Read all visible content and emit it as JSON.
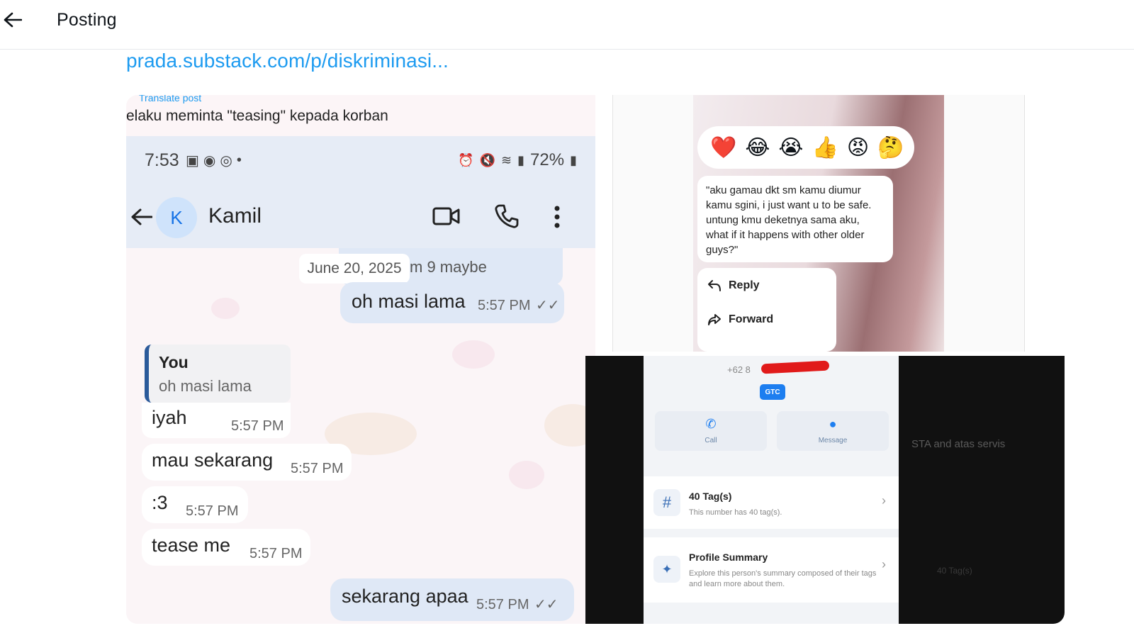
{
  "header": {
    "title": "Posting",
    "back_icon": "arrow-left-icon"
  },
  "post": {
    "link_text": "prada.substack.com/p/diskriminasi..."
  },
  "chat_screenshot": {
    "translate_label": "Translate post",
    "caption": "elaku meminta \"teasing\" kepada korban",
    "status_time": "7:53",
    "status_battery": "72%",
    "contact_initial": "K",
    "contact_name": "Kamil",
    "date_chip": "June 20, 2025",
    "top_partial": "m 9 maybe",
    "messages": [
      {
        "dir": "out",
        "text": "oh masi lama",
        "time": "5:57 PM"
      },
      {
        "dir": "in",
        "text": "iyah",
        "time": "5:57 PM"
      },
      {
        "dir": "in",
        "text": "mau sekarang",
        "time": "5:57 PM"
      },
      {
        "dir": "in",
        "text": ":3",
        "time": "5:57 PM"
      },
      {
        "dir": "in",
        "text": "tease me",
        "time": "5:57 PM"
      },
      {
        "dir": "out",
        "text": "sekarang apaa",
        "time": "5:57 PM"
      }
    ],
    "quote": {
      "who": "You",
      "text": "oh masi lama"
    }
  },
  "reaction_screenshot": {
    "emojis": [
      "❤️",
      "😂",
      "😭",
      "👍",
      "😡",
      "🤔"
    ],
    "message": "\"aku gamau dkt sm kamu diumur kamu sgini, i just want u to be safe. untung kmu deketnya sama aku, what if it happens with other older guys?\"",
    "menu": [
      {
        "label": "Reply",
        "icon": "reply-icon"
      },
      {
        "label": "Forward",
        "icon": "forward-icon"
      }
    ]
  },
  "contact_screenshot": {
    "number": "+62 8",
    "badge": "GTC",
    "actions": [
      {
        "label": "Call",
        "icon": "phone-icon"
      },
      {
        "label": "Message",
        "icon": "message-icon"
      }
    ],
    "rows": [
      {
        "title": "40 Tag(s)",
        "subtitle": "This number has 40 tag(s).",
        "icon": "hash-icon"
      },
      {
        "title": "Profile Summary",
        "subtitle": "Explore this person's summary composed of their tags and learn more about them.",
        "icon": "sparkle-icon"
      }
    ],
    "ghost_text": "STA and atas servis",
    "ghost_tags": "40 Tag(s)"
  },
  "colors": {
    "link": "#1d9bf0",
    "chat_header": "#e6ecf6",
    "bubble_out": "#dfe8f6",
    "accent_blue": "#1d7ef0",
    "scribble_red": "#e11a1a"
  }
}
